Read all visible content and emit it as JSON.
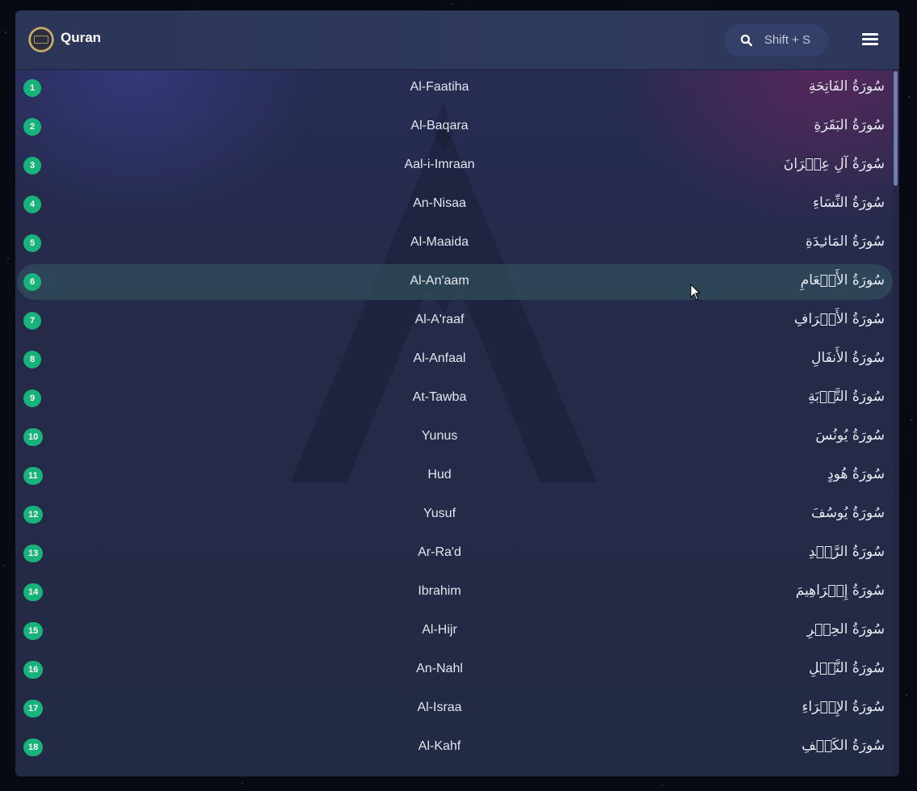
{
  "header": {
    "title": "Quran",
    "search_hint": "Shift + S"
  },
  "surahs": [
    {
      "number": "1",
      "name": "Al-Faatiha",
      "arabic": "سُورَةُ الفَاتِحَةِ"
    },
    {
      "number": "2",
      "name": "Al-Baqara",
      "arabic": "سُورَةُ البَقَرَةِ"
    },
    {
      "number": "3",
      "name": "Aal-i-Imraan",
      "arabic": "سُورَةُ آلِ عِمۡرَانَ"
    },
    {
      "number": "4",
      "name": "An-Nisaa",
      "arabic": "سُورَةُ النِّسَاءِ"
    },
    {
      "number": "5",
      "name": "Al-Maaida",
      "arabic": "سُورَةُ المَائـِدَةِ"
    },
    {
      "number": "6",
      "name": "Al-An'aam",
      "arabic": "سُورَةُ الأَنۡعَامِ"
    },
    {
      "number": "7",
      "name": "Al-A'raaf",
      "arabic": "سُورَةُ الأَعۡرَافِ"
    },
    {
      "number": "8",
      "name": "Al-Anfaal",
      "arabic": "سُورَةُ الأَنفَالِ"
    },
    {
      "number": "9",
      "name": "At-Tawba",
      "arabic": "سُورَةُ التَّوۡبَةِ"
    },
    {
      "number": "10",
      "name": "Yunus",
      "arabic": "سُورَةُ يُونُسَ"
    },
    {
      "number": "11",
      "name": "Hud",
      "arabic": "سُورَةُ هُودٍ"
    },
    {
      "number": "12",
      "name": "Yusuf",
      "arabic": "سُورَةُ يُوسُفَ"
    },
    {
      "number": "13",
      "name": "Ar-Ra'd",
      "arabic": "سُورَةُ الرَّعۡدِ"
    },
    {
      "number": "14",
      "name": "Ibrahim",
      "arabic": "سُورَةُ إِبۡرَاهِيمَ"
    },
    {
      "number": "15",
      "name": "Al-Hijr",
      "arabic": "سُورَةُ الحِجۡرِ"
    },
    {
      "number": "16",
      "name": "An-Nahl",
      "arabic": "سُورَةُ النَّحۡلِ"
    },
    {
      "number": "17",
      "name": "Al-Israa",
      "arabic": "سُورَةُ الإِسۡرَاءِ"
    },
    {
      "number": "18",
      "name": "Al-Kahf",
      "arabic": "سُورَةُ الكَهۡفِ"
    }
  ],
  "colors": {
    "badge": "#18b37a",
    "hover_row": "#345660"
  },
  "icons": {
    "logo": "quran-logo-icon",
    "search": "search-icon",
    "menu": "hamburger-menu-icon",
    "cursor": "mouse-pointer-icon"
  }
}
